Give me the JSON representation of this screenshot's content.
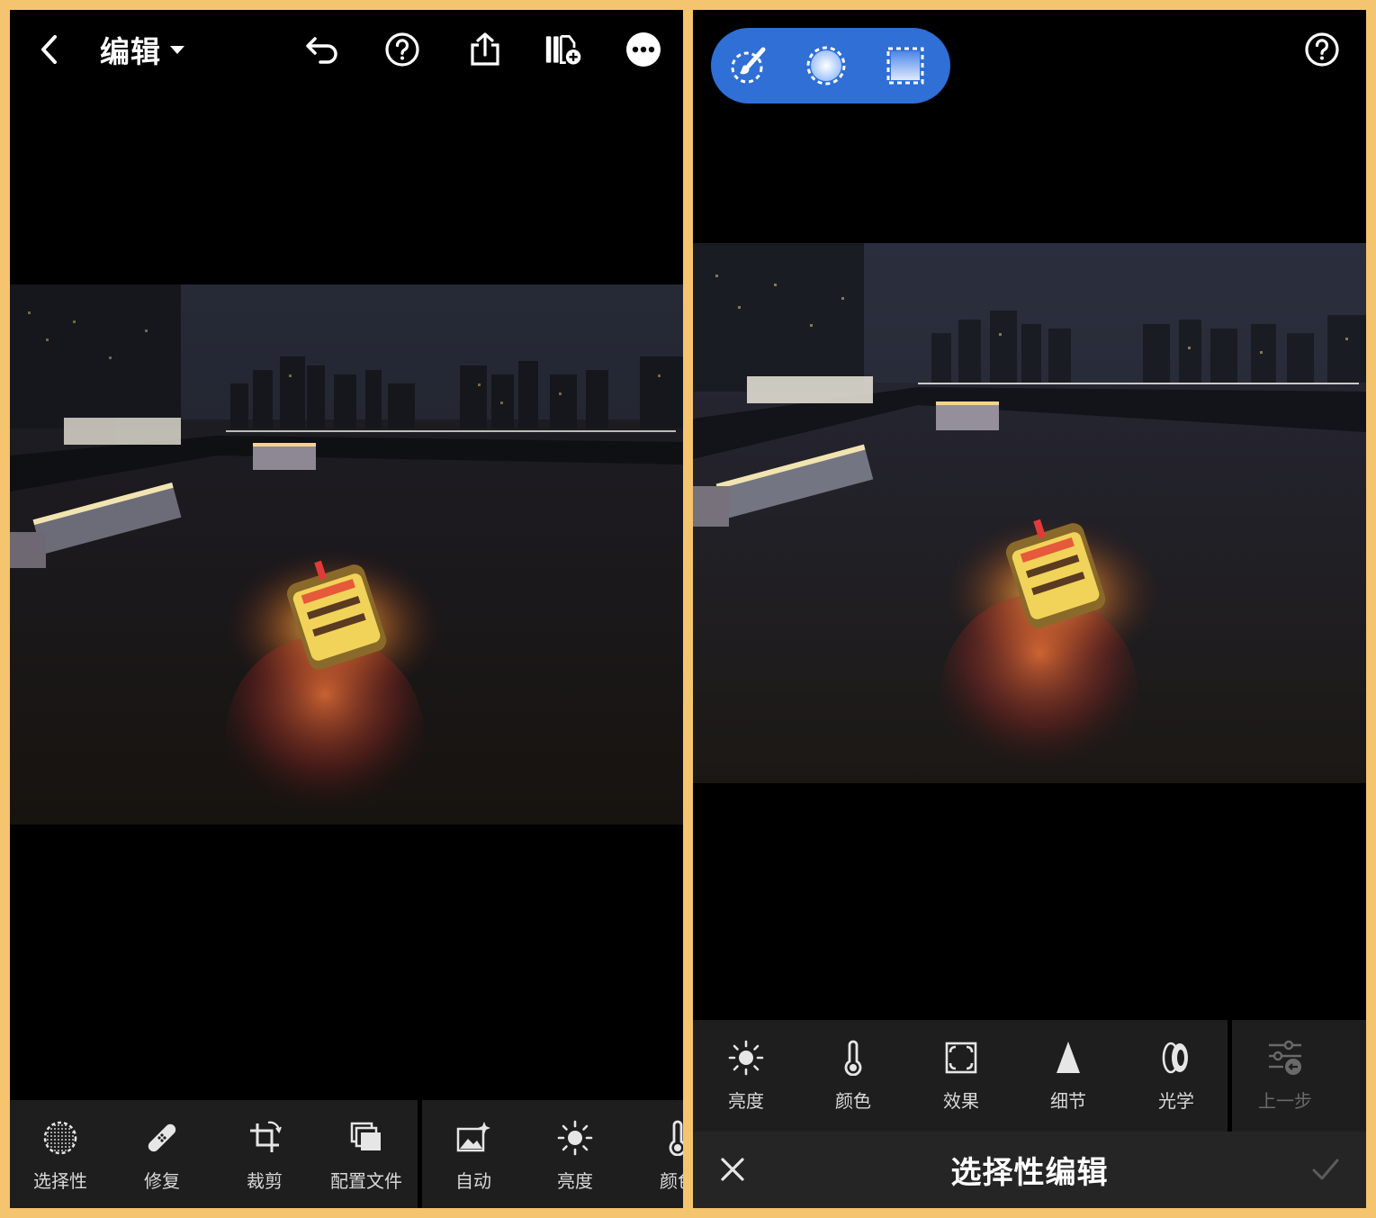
{
  "left": {
    "header": {
      "title": "编辑"
    },
    "toolbar": [
      {
        "label": "选择性",
        "icon": "selective-icon"
      },
      {
        "label": "修复",
        "icon": "bandage-icon"
      },
      {
        "label": "裁剪",
        "icon": "crop-rotate-icon"
      },
      {
        "label": "配置文件",
        "icon": "profiles-icon"
      },
      {
        "label": "自动",
        "icon": "auto-icon"
      },
      {
        "label": "亮度",
        "icon": "sun-icon"
      },
      {
        "label": "颜色",
        "icon": "thermometer-icon"
      }
    ]
  },
  "right": {
    "mask_tools": [
      "brush-mask-icon",
      "radial-mask-icon",
      "linear-mask-icon"
    ],
    "tools": [
      {
        "label": "亮度",
        "icon": "sun-icon"
      },
      {
        "label": "颜色",
        "icon": "thermometer-icon"
      },
      {
        "label": "效果",
        "icon": "effects-icon"
      },
      {
        "label": "细节",
        "icon": "detail-icon"
      },
      {
        "label": "光学",
        "icon": "lens-icon"
      },
      {
        "label": "上一步",
        "icon": "previous-icon",
        "disabled": true
      }
    ],
    "confirm_bar": {
      "title": "选择性编辑"
    }
  },
  "colors": {
    "frame": "#f5c46e",
    "accent": "#2f6fd6",
    "toolbar": "#1e1e1e"
  }
}
